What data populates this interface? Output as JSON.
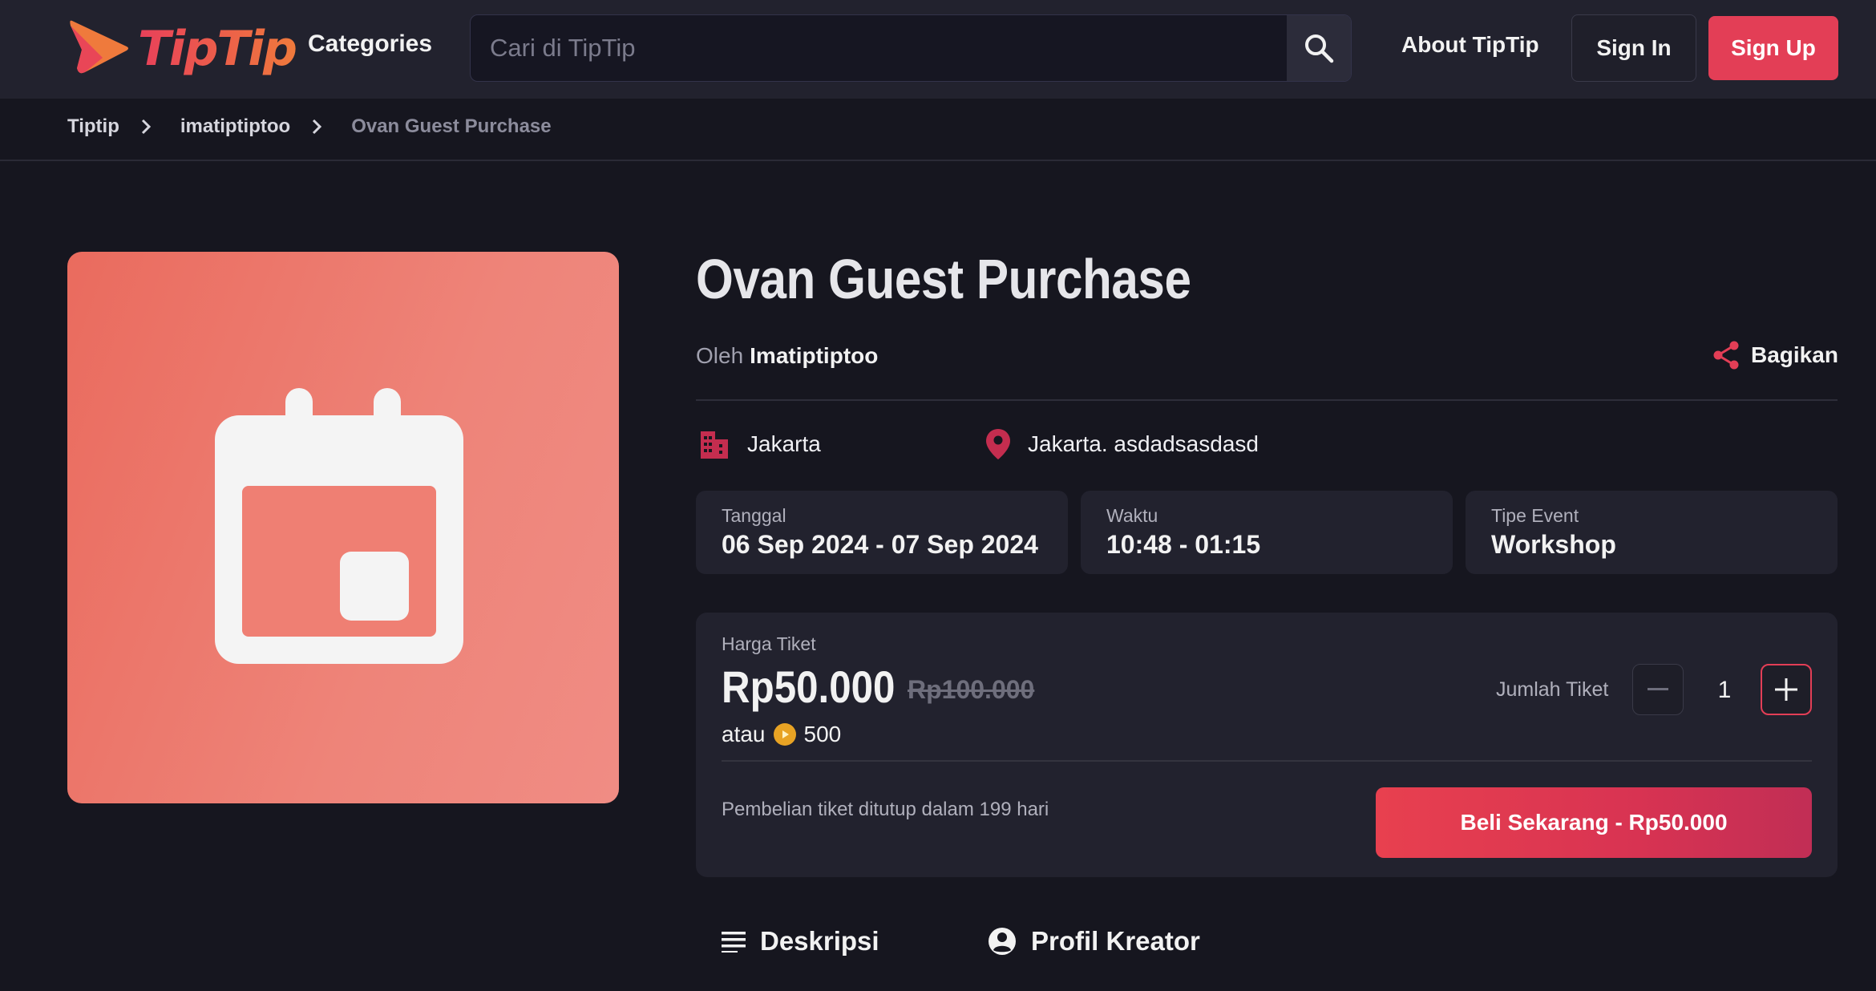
{
  "colors": {
    "accent": "#e33e56",
    "page_bg": "#16161f",
    "header_bg": "#22222e",
    "card_bg": "#22222e",
    "image_bg": "#ee7e72",
    "coin": "#e8a324"
  },
  "header": {
    "logo_text": "TipTip",
    "categories_label": "Categories",
    "search_placeholder": "Cari di TipTip",
    "about_label": "About TipTip",
    "signin_label": "Sign In",
    "signup_label": "Sign Up"
  },
  "breadcrumb": [
    "Tiptip",
    "imatiptiptoo",
    "Ovan Guest Purchase"
  ],
  "event": {
    "title": "Ovan Guest Purchase",
    "by_prefix": "Oleh",
    "creator": "Imatiptiptoo",
    "share_label": "Bagikan",
    "city": "Jakarta",
    "address": "Jakarta. asdadsasdasd",
    "info": [
      {
        "label": "Tanggal",
        "value": "06 Sep 2024 - 07 Sep 2024"
      },
      {
        "label": "Waktu",
        "value": "10:48 - 01:15"
      },
      {
        "label": "Tipe Event",
        "value": "Workshop"
      }
    ]
  },
  "ticket": {
    "label": "Harga Tiket",
    "price": "Rp50.000",
    "original_price": "Rp100.000",
    "alt_prefix": "atau",
    "coin_amount": "500",
    "quantity_label": "Jumlah Tiket",
    "quantity": "1",
    "closing_note": "Pembelian tiket ditutup dalam 199 hari",
    "buy_label": "Beli Sekarang - Rp50.000"
  },
  "tabs": [
    "Deskripsi",
    "Profil Kreator"
  ],
  "icons": {
    "logo": "play-arrow-logo-icon",
    "search": "search-icon",
    "chevron": "chevron-right-icon",
    "calendar": "calendar-icon",
    "share": "share-icon",
    "building": "building-icon",
    "location": "location-pin-icon",
    "coin": "coin-icon",
    "minus": "minus-icon",
    "plus": "plus-icon",
    "description": "description-lines-icon",
    "profile": "account-circle-icon"
  }
}
